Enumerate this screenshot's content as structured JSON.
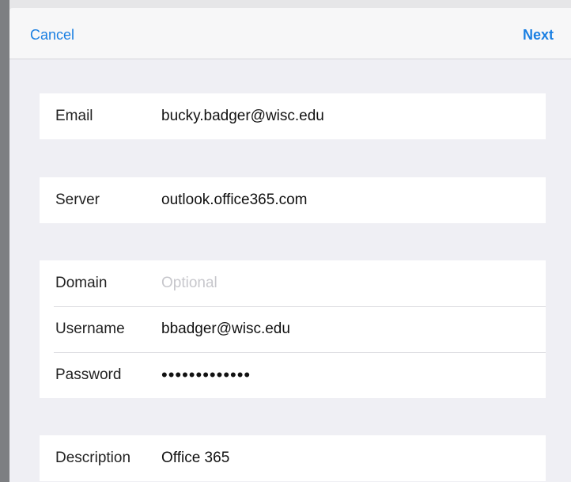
{
  "navbar": {
    "cancel_label": "Cancel",
    "next_label": "Next"
  },
  "account": {
    "email_label": "Email",
    "email_value": "bucky.badger@wisc.edu"
  },
  "server": {
    "server_label": "Server",
    "server_value": "outlook.office365.com"
  },
  "credentials": {
    "domain_label": "Domain",
    "domain_value": "",
    "domain_placeholder": "Optional",
    "username_label": "Username",
    "username_value": "bbadger@wisc.edu",
    "password_label": "Password",
    "password_masked": "•••••••••••••"
  },
  "description": {
    "description_label": "Description",
    "description_value": "Office 365"
  },
  "colors": {
    "accent": "#1a7fe2",
    "background": "#efeff4",
    "placeholder": "#c7c7cc"
  }
}
